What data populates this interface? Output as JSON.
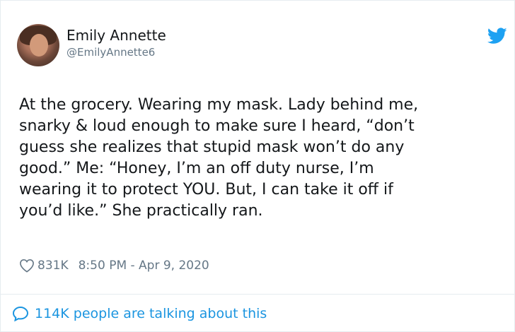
{
  "author": {
    "name": "Emily Annette",
    "handle": "@EmilyAnnette6"
  },
  "tweet": {
    "text": "At the grocery. Wearing my mask. Lady behind me,\nsnarky & loud enough to make sure I heard, “don’t\nguess she realizes that stupid mask won’t do any\ngood.” Me: “Honey, I’m an off duty nurse, I’m\nwearing it to protect YOU. But, I can take it off if\nyou’d like.” She practically ran."
  },
  "meta": {
    "likes": "831K",
    "time": "8:50 PM - Apr 9, 2020"
  },
  "footer": {
    "talking": "114K people are talking about this"
  },
  "icons": {
    "logo": "twitter-bird-icon",
    "like": "heart-icon",
    "reply": "speech-bubble-icon"
  },
  "colors": {
    "brand_blue": "#1da1f2",
    "link_blue": "#1b95e0",
    "text": "#14171a",
    "muted": "#657786",
    "border": "#e6ecf0"
  }
}
